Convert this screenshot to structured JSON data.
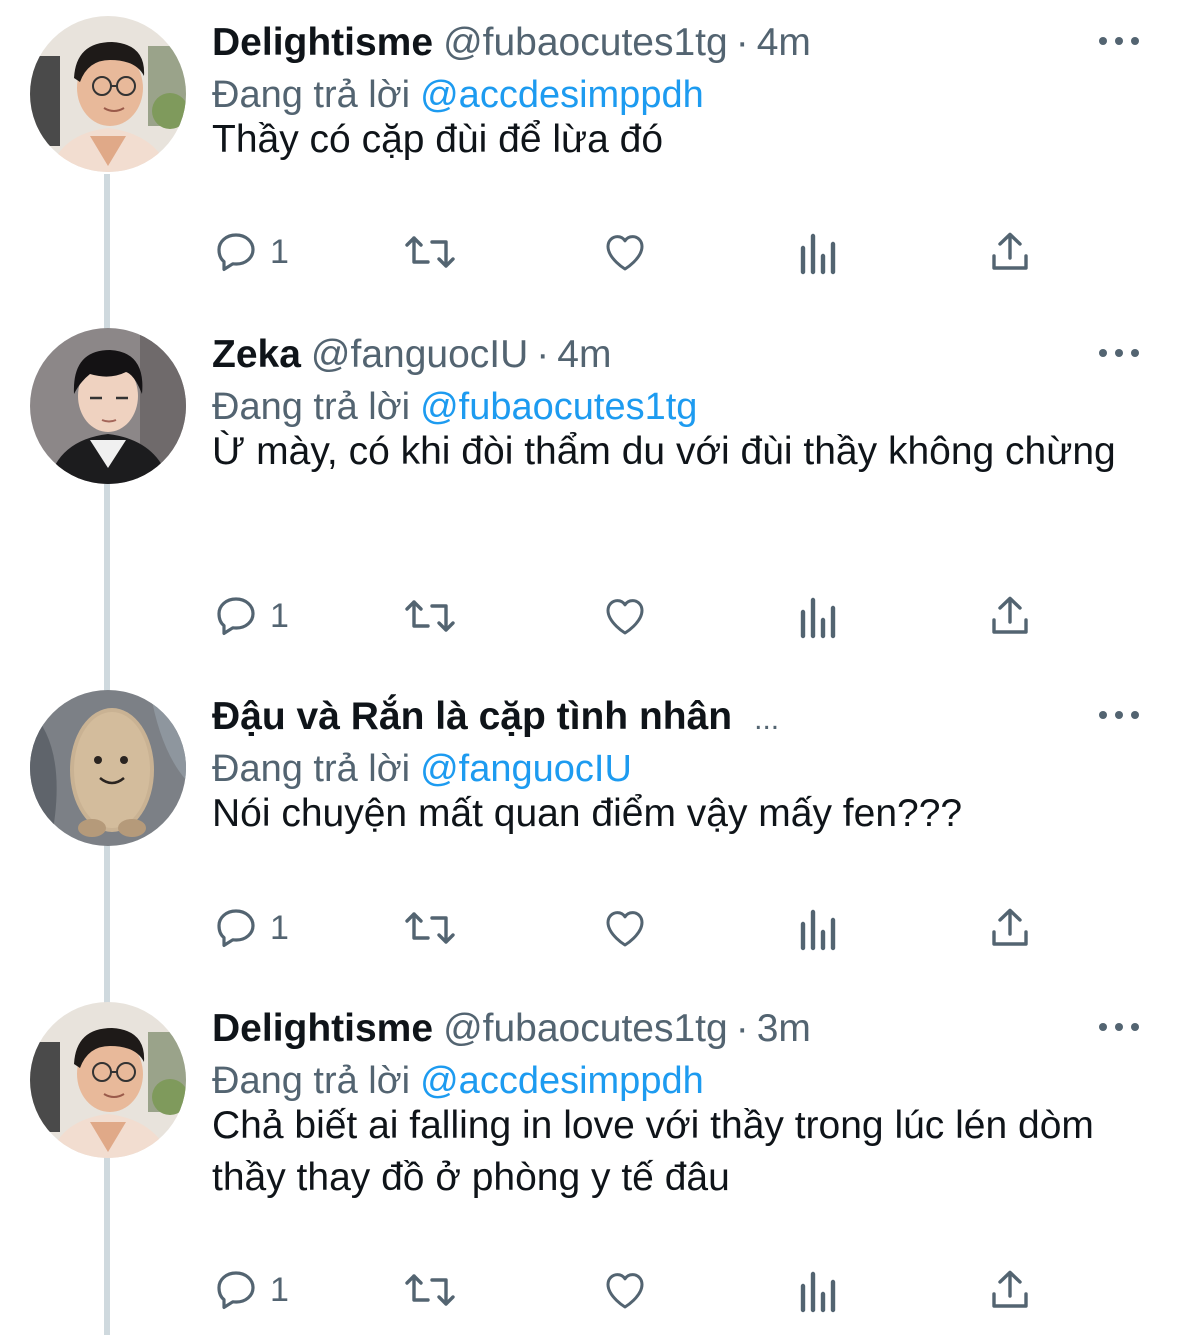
{
  "colors": {
    "text_primary": "#0f1419",
    "text_secondary": "#536471",
    "link": "#1d9bf0",
    "thread_line": "#cfd9de"
  },
  "reply_prefix": "Đang trả lời",
  "tweets": [
    {
      "display_name": "Delightisme",
      "handle": "@fubaocutes1tg",
      "separator": "·",
      "time": "4m",
      "replying_to": "@accdesimppdh",
      "text": "Thầy có cặp đùi để lừa đó",
      "reply_count": "1",
      "avatar": "avatar-delightisme"
    },
    {
      "display_name": "Zeka",
      "handle": "@fanguocIU",
      "separator": "·",
      "time": "4m",
      "replying_to": "@fubaocutes1tg",
      "text": "Ừ mày, có khi đòi thẩm du với đùi thầy không chừng",
      "reply_count": "1",
      "avatar": "avatar-zeka"
    },
    {
      "display_name": "Đậu và Rắn là cặp tình nhân",
      "truncation": "...",
      "replying_to": "@fanguocIU",
      "text": "Nói chuyện mất quan điểm vậy mấy fen???",
      "reply_count": "1",
      "avatar": "avatar-plush"
    },
    {
      "display_name": "Delightisme",
      "handle": "@fubaocutes1tg",
      "separator": "·",
      "time": "3m",
      "replying_to": "@accdesimppdh",
      "text": "Chả biết ai falling in love với thầy trong lúc lén dòm thầy thay đồ ở phòng y tế đâu",
      "reply_count": "1",
      "avatar": "avatar-delightisme"
    }
  ],
  "icons": {
    "reply": "reply-icon",
    "retweet": "retweet-icon",
    "like": "heart-icon",
    "views": "analytics-icon",
    "share": "share-icon",
    "more": "more-icon"
  }
}
